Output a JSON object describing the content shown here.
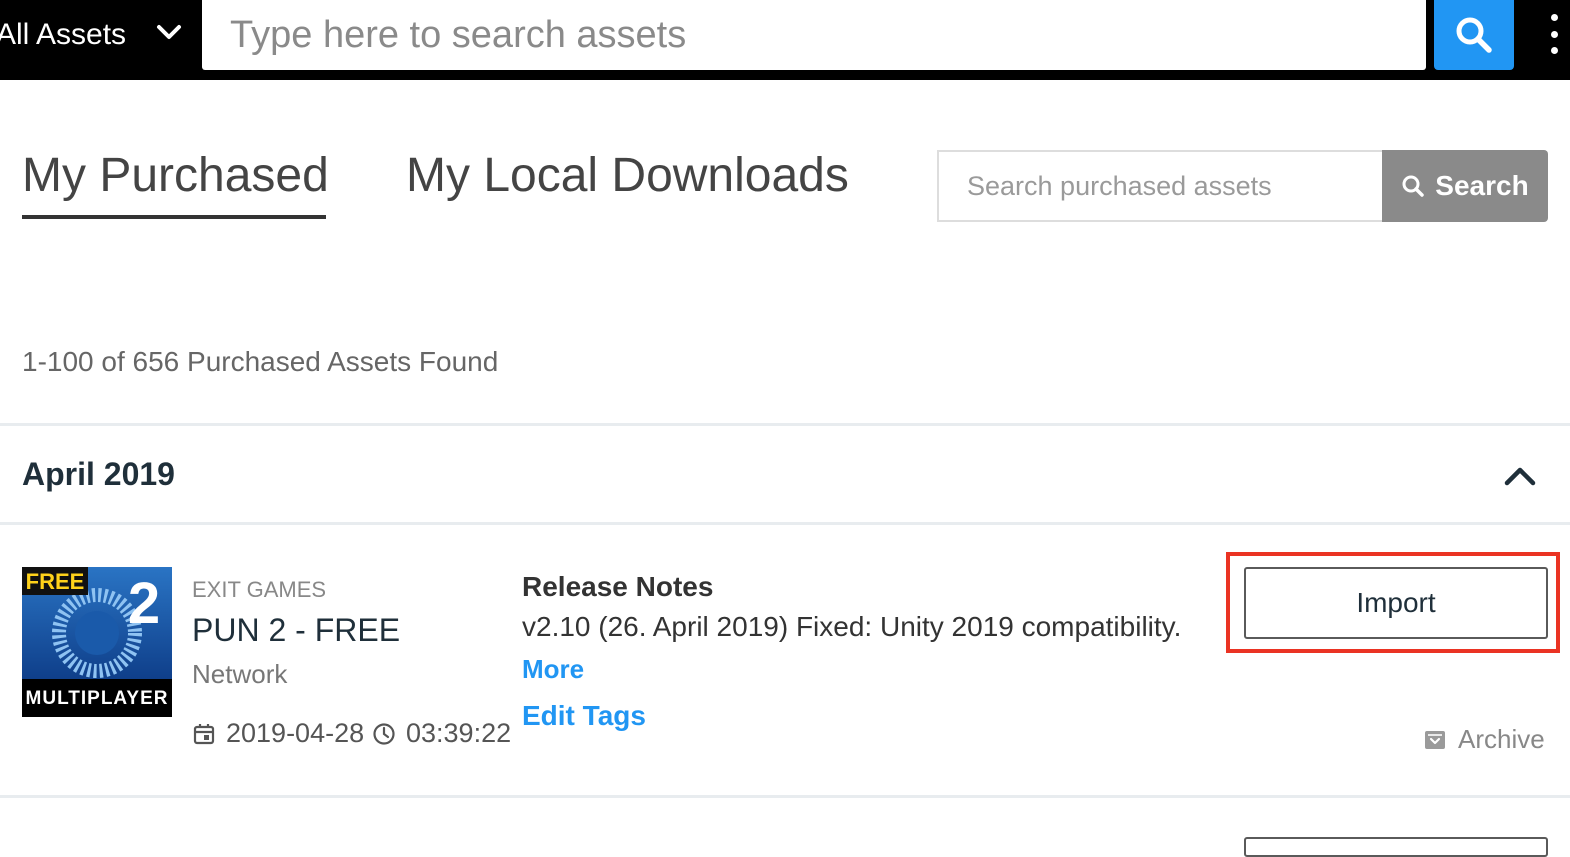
{
  "topbar": {
    "scope_label": "All Assets",
    "search_placeholder": "Type here to search assets"
  },
  "tabs": [
    {
      "label": "My Purchased",
      "active": true
    },
    {
      "label": "My Local Downloads",
      "active": false
    }
  ],
  "local_search": {
    "placeholder": "Search purchased assets",
    "button_label": "Search"
  },
  "results": {
    "summary": "1-100 of 656 Purchased Assets Found"
  },
  "group": {
    "title": "April 2019"
  },
  "asset": {
    "thumbnail": {
      "badge_free": "FREE",
      "badge_number": "2",
      "caption": "MULTIPLAYER"
    },
    "publisher": "EXIT GAMES",
    "name": "PUN 2 - FREE",
    "category": "Network",
    "date": "2019-04-28",
    "time": "03:39:22",
    "release_notes_title": "Release Notes",
    "release_notes_text": "v2.10 (26. April 2019) Fixed: Unity 2019 compatibility.",
    "more_label": "More",
    "edit_tags_label": "Edit Tags",
    "import_label": "Import",
    "archive_label": "Archive"
  },
  "colors": {
    "accent_blue": "#2196f3",
    "highlight_red": "#ea3323",
    "search_button_gray": "#8a8a8a",
    "heading_dark": "#1f2f3a"
  }
}
